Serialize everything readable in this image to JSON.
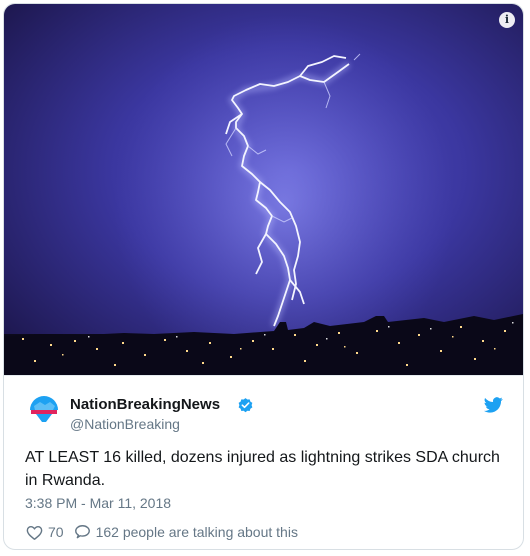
{
  "media": {
    "info_icon": "info-icon"
  },
  "tweet": {
    "display_name": "NationBreakingNews",
    "handle": "@NationBreaking",
    "text": "AT LEAST 16 killed, dozens injured as lightning strikes SDA church in Rwanda.",
    "timestamp": "3:38 PM - Mar 11, 2018",
    "like_count": "70",
    "talking": "162 people are talking about this"
  },
  "colors": {
    "twitter_blue": "#1da1f2",
    "text": "#14171a",
    "muted": "#657786",
    "sky_top": "#221a53",
    "sky_bottom": "#4a47b4",
    "bolt": "#eef0ff"
  },
  "icons": [
    "info-icon",
    "verified-icon",
    "twitter-bird-icon",
    "heart-icon",
    "reply-icon"
  ]
}
